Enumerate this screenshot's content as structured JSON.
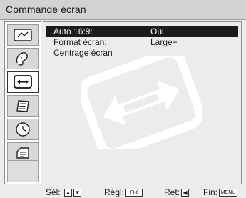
{
  "screen_title": "Commande écran",
  "icons": [
    {
      "name": "picture-adjust-icon",
      "selected": false
    },
    {
      "name": "sound-icon",
      "selected": false
    },
    {
      "name": "screen-control-icon",
      "selected": true
    },
    {
      "name": "channel-preset-icon",
      "selected": false
    },
    {
      "name": "timer-icon",
      "selected": false
    },
    {
      "name": "setup-icon",
      "selected": false
    }
  ],
  "menu": {
    "items": [
      {
        "label": "Auto 16:9:",
        "value": "Oui",
        "highlighted": true
      },
      {
        "label": "Format écran:",
        "value": "Large+",
        "highlighted": false
      },
      {
        "label": "Centrage écran",
        "value": "",
        "highlighted": false
      }
    ]
  },
  "footer": {
    "select_label": "Sél:",
    "select_keys": [
      "up-arrow-icon",
      "down-arrow-icon"
    ],
    "adjust_label": "Régl:",
    "adjust_key": "OK",
    "back_label": "Ret:",
    "back_key": "left-arrow-icon",
    "end_label": "Fin:",
    "end_key": "MENU"
  },
  "colors": {
    "highlight": "#1b1b1b",
    "panel": "#ececec",
    "title_bar": "#d2d2d2"
  }
}
